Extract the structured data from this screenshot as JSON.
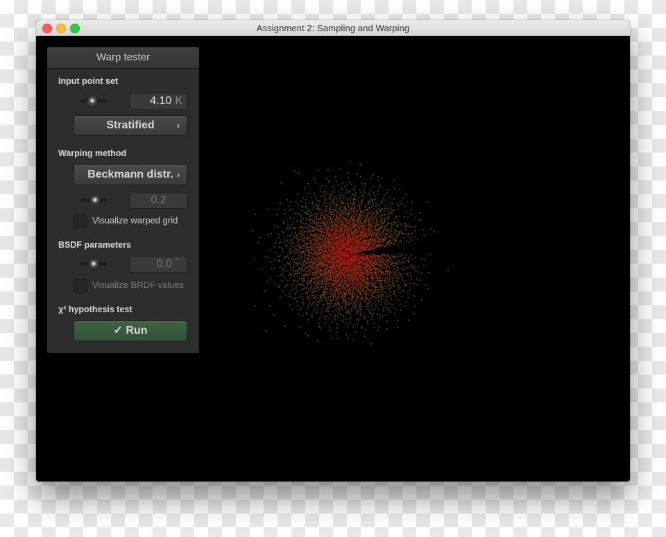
{
  "window": {
    "title": "Assignment 2: Sampling and Warping",
    "controls": [
      "close",
      "minimize",
      "maximize"
    ]
  },
  "panel": {
    "title": "Warp tester",
    "input_point_set": {
      "label": "Input point set",
      "slider_fraction": 0.45,
      "value": "4.10",
      "unit": "K",
      "sampler_button": "Stratified",
      "sampler_chevron": "›"
    },
    "warping_method": {
      "label": "Warping method",
      "method_button": "Beckmann distr.",
      "method_chevron": "›",
      "slider_fraction": 0.55,
      "param_value": "0.2",
      "visualize_grid_label": "Visualize warped grid",
      "visualize_grid_checked": false
    },
    "bsdf_parameters": {
      "label": "BSDF parameters",
      "slider_fraction": 0.5,
      "angle_value": "0.0",
      "angle_unit": "°",
      "visualize_brdf_label": "Visualize BRDF values",
      "visualize_brdf_checked": false,
      "enabled": false
    },
    "hypothesis_test": {
      "label": "χ² hypothesis test",
      "run_icon": "✓",
      "run_label": "Run"
    }
  },
  "visualization": {
    "description": "Warped point cloud, Beckmann distribution",
    "point_count": 4100,
    "center_color": "#e02010",
    "edge_color": "#22c010",
    "background": "#000000"
  }
}
